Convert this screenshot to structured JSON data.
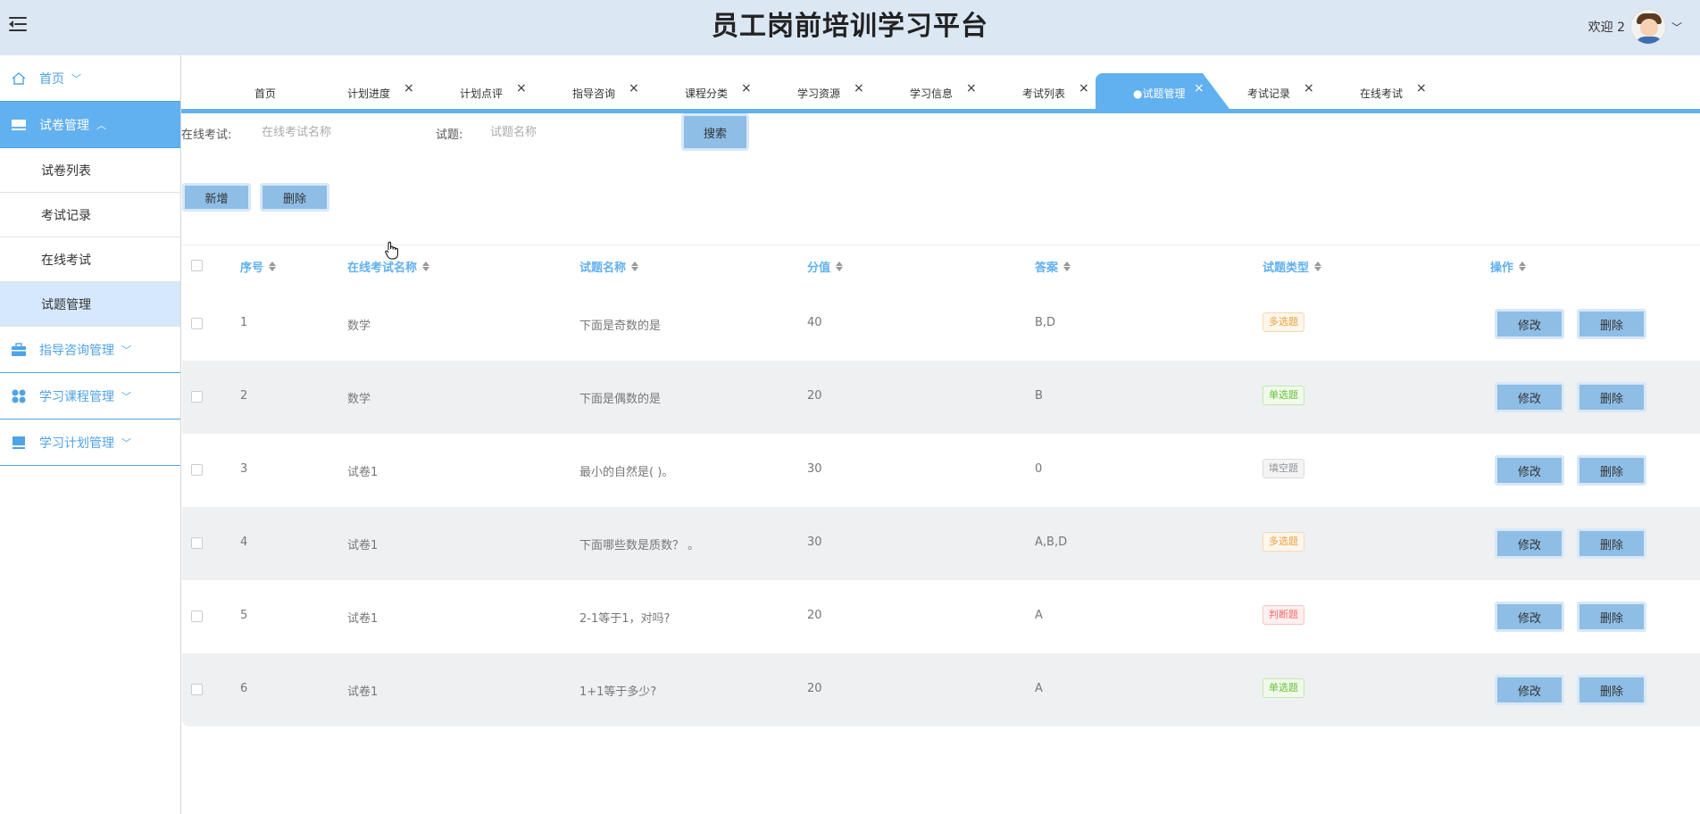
{
  "app": {
    "title": "员工岗前培训学习平台",
    "welcome": "欢迎 2"
  },
  "sidebar": {
    "items": [
      {
        "label": "首页",
        "icon": "home-icon",
        "arrow": "﹀"
      },
      {
        "label": "试卷管理",
        "icon": "folder-icon",
        "arrow": "︿"
      },
      {
        "label": "指导咨询管理",
        "icon": "briefcase-icon",
        "arrow": "﹀"
      },
      {
        "label": "学习课程管理",
        "icon": "grid-icon",
        "arrow": "﹀"
      },
      {
        "label": "学习计划管理",
        "icon": "book-icon",
        "arrow": "﹀"
      }
    ],
    "subitems": [
      {
        "label": "试卷列表"
      },
      {
        "label": "考试记录"
      },
      {
        "label": "在线考试"
      },
      {
        "label": "试题管理"
      }
    ]
  },
  "tabs": [
    {
      "label": "首页"
    },
    {
      "label": "计划进度",
      "close": "×"
    },
    {
      "label": "计划点评",
      "close": "×"
    },
    {
      "label": "指导咨询",
      "close": "×"
    },
    {
      "label": "课程分类",
      "close": "×"
    },
    {
      "label": "学习资源",
      "close": "×"
    },
    {
      "label": "学习信息",
      "close": "×"
    },
    {
      "label": "考试列表",
      "close": "×"
    },
    {
      "label": "●试题管理",
      "close": "×"
    },
    {
      "label": "考试记录",
      "close": "×"
    },
    {
      "label": "在线考试",
      "close": "×"
    }
  ],
  "search": {
    "exam_label": "在线考试:",
    "exam_placeholder": "在线考试名称",
    "question_label": "试题:",
    "question_placeholder": "试题名称",
    "search_button": "搜索"
  },
  "toolbar": {
    "add_label": "新增",
    "delete_label": "删除"
  },
  "table": {
    "headers": [
      "序号",
      "在线考试名称",
      "试题名称",
      "分值",
      "答案",
      "试题类型",
      "操作"
    ],
    "edit_label": "修改",
    "delete_label": "删除",
    "rows": [
      {
        "no": "1",
        "exam": "数学",
        "question": "下面是奇数的是",
        "score": "40",
        "answer": "B,D",
        "type": "多选题"
      },
      {
        "no": "2",
        "exam": "数学",
        "question": "下面是偶数的是",
        "score": "20",
        "answer": "B",
        "type": "单选题"
      },
      {
        "no": "3",
        "exam": "试卷1",
        "question": "最小的自然是( )。",
        "score": "30",
        "answer": "0",
        "type": "填空题"
      },
      {
        "no": "4",
        "exam": "试卷1",
        "question": "下面哪些数是质数？ 。",
        "score": "30",
        "answer": "A,B,D",
        "type": "多选题"
      },
      {
        "no": "5",
        "exam": "试卷1",
        "question": "2-1等于1，对吗?",
        "score": "20",
        "answer": "A",
        "type": "判断题"
      },
      {
        "no": "6",
        "exam": "试卷1",
        "question": "1+1等于多少?",
        "score": "20",
        "answer": "A",
        "type": "单选题"
      }
    ]
  },
  "colors": {
    "accent": "#61b0f0",
    "header_bg": "#dce7f4",
    "button_bg": "#8ebde6",
    "tag_multi": "#e6a23c",
    "tag_single": "#67c23a",
    "tag_fill": "#909399",
    "tag_judge": "#f56c6c"
  }
}
